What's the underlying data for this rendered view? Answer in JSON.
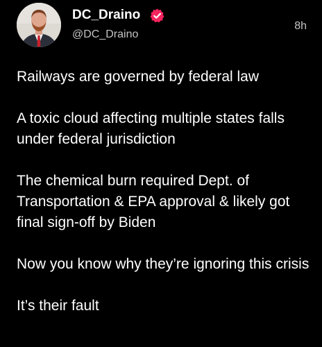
{
  "author": {
    "display_name": "DC_Draino",
    "handle": "@DC_Draino",
    "verified": true
  },
  "post": {
    "timestamp": "8h",
    "paragraphs": [
      "Railways are governed by federal law",
      "A toxic cloud affecting multiple states falls under federal jurisdiction",
      "The chemical burn required Dept. of Transportation & EPA approval & likely got final sign-off by Biden",
      "Now you know why they’re ignoring this crisis",
      "It’s their fault"
    ]
  },
  "colors": {
    "background": "#000000",
    "text_primary": "#ffffff",
    "text_secondary": "#c4c4c4",
    "verified_badge": "#f4245e"
  },
  "icons": {
    "verified": "verified-badge-icon",
    "avatar": "profile-photo"
  }
}
